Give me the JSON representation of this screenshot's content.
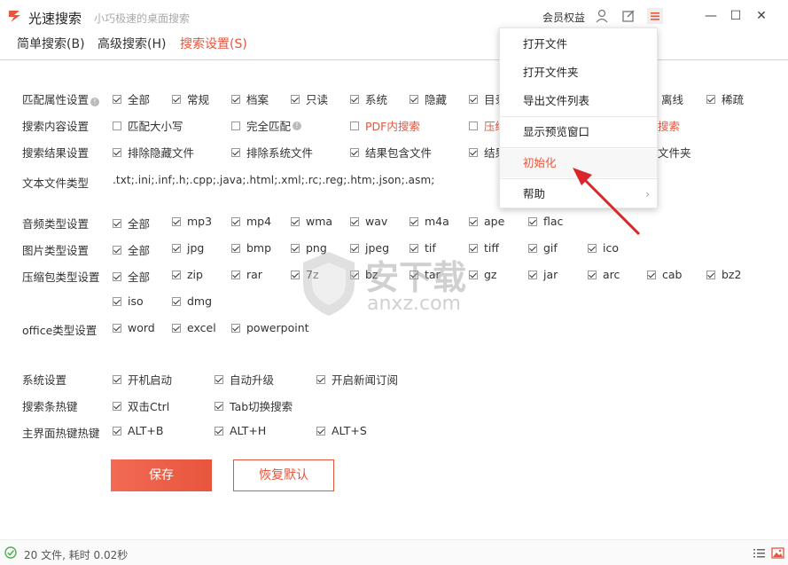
{
  "titlebar": {
    "title": "光速搜索",
    "subtitle": "小巧极速的桌面搜索",
    "member": "会员权益",
    "icons": [
      "user-icon",
      "edit-icon",
      "menu-icon"
    ],
    "window_controls": {
      "minimize": "—",
      "maximize": "☐",
      "close": "✕"
    }
  },
  "tabs": [
    {
      "label": "简单搜索(B)",
      "active": false
    },
    {
      "label": "高级搜索(H)",
      "active": false
    },
    {
      "label": "搜索设置(S)",
      "active": true
    }
  ],
  "settings": {
    "match_attr": {
      "label": "匹配属性设置",
      "options": [
        "全部",
        "常规",
        "档案",
        "只读",
        "系统",
        "隐藏",
        "目录",
        "离线",
        "稀疏"
      ]
    },
    "search_content": {
      "label": "搜索内容设置",
      "options": [
        "匹配大小写",
        "完全匹配",
        "PDF内搜索",
        "压缩",
        "搜索"
      ]
    },
    "search_result": {
      "label": "搜索结果设置",
      "options": [
        "排除隐藏文件",
        "排除系统文件",
        "结果包含文件",
        "结果",
        "文件夹"
      ]
    },
    "text_types": {
      "label": "文本文件类型",
      "value": ".txt;.ini;.inf;.h;.cpp;.java;.html;.xml;.rc;.reg;.htm;.json;.asm;"
    },
    "audio_types": {
      "label": "音频类型设置",
      "options": [
        "全部",
        "mp3",
        "mp4",
        "wma",
        "wav",
        "m4a",
        "ape",
        "flac"
      ]
    },
    "image_types": {
      "label": "图片类型设置",
      "options": [
        "全部",
        "jpg",
        "bmp",
        "png",
        "jpeg",
        "tif",
        "tiff",
        "gif",
        "ico"
      ]
    },
    "archive_types": {
      "label": "压缩包类型设置",
      "options": [
        "全部",
        "zip",
        "rar",
        "7z",
        "bz",
        "tar",
        "gz",
        "jar",
        "arc",
        "cab",
        "bz2",
        "iso",
        "dmg"
      ]
    },
    "office_types": {
      "label": "office类型设置",
      "options": [
        "word",
        "excel",
        "powerpoint"
      ]
    },
    "system": {
      "label": "系统设置",
      "options": [
        "开机启动",
        "自动升级",
        "开启新闻订阅"
      ]
    },
    "search_hotkey": {
      "label": "搜索条热键",
      "options": [
        "双击Ctrl",
        "Tab切换搜索"
      ]
    },
    "main_hotkey": {
      "label": "主界面热键热键",
      "options": [
        "ALT+B",
        "ALT+H",
        "ALT+S"
      ]
    }
  },
  "buttons": {
    "save": "保存",
    "reset": "恢复默认"
  },
  "status": {
    "text": "20 文件, 耗时 0.02秒"
  },
  "menu": {
    "items": [
      "打开文件",
      "打开文件夹",
      "导出文件列表",
      "显示预览窗口",
      "初始化",
      "帮助"
    ],
    "highlighted": "初始化",
    "submenu_arrow": "›"
  },
  "watermark": {
    "text_cn": "安下载",
    "text_en": "anxz.com"
  },
  "colors": {
    "accent": "#e8553d",
    "text": "#333333",
    "muted": "#aaaaaa"
  }
}
